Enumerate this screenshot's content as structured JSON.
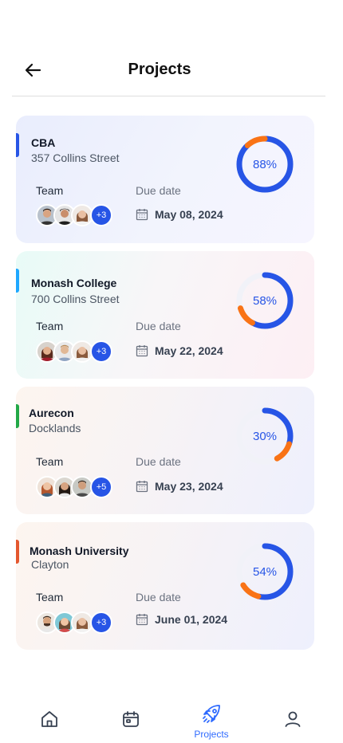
{
  "header": {
    "title": "Projects"
  },
  "labels": {
    "team": "Team",
    "due_date": "Due date"
  },
  "colors": {
    "primary": "#2755e6",
    "orange": "#f97316",
    "track": "#f1f2f8"
  },
  "projects": [
    {
      "name": "CBA",
      "address": "357 Collins Street",
      "progress_pct": 88,
      "progress_label": "88%",
      "team_more": "+3",
      "due": "May 08, 2024",
      "accent": "#2755e6"
    },
    {
      "name": "Monash College",
      "address": "700 Collins Street",
      "progress_pct": 58,
      "progress_label": "58%",
      "team_more": "+3",
      "due": "May 22, 2024",
      "accent": "#1ea7ff"
    },
    {
      "name": "Aurecon",
      "address": "Docklands",
      "progress_pct": 30,
      "progress_label": "30%",
      "team_more": "+5",
      "due": "May 23, 2024",
      "accent": "#22a847"
    },
    {
      "name": "Monash University",
      "address": "Clayton",
      "progress_pct": 54,
      "progress_label": "54%",
      "team_more": "+3",
      "due": "June 01, 2024",
      "accent": "#e4572e"
    }
  ],
  "nav": [
    {
      "id": "home",
      "icon": "home-icon",
      "label": ""
    },
    {
      "id": "calendar",
      "icon": "calendar-icon",
      "label": ""
    },
    {
      "id": "projects",
      "icon": "rocket-icon",
      "label": "Projects",
      "active": true
    },
    {
      "id": "profile",
      "icon": "user-icon",
      "label": ""
    }
  ]
}
